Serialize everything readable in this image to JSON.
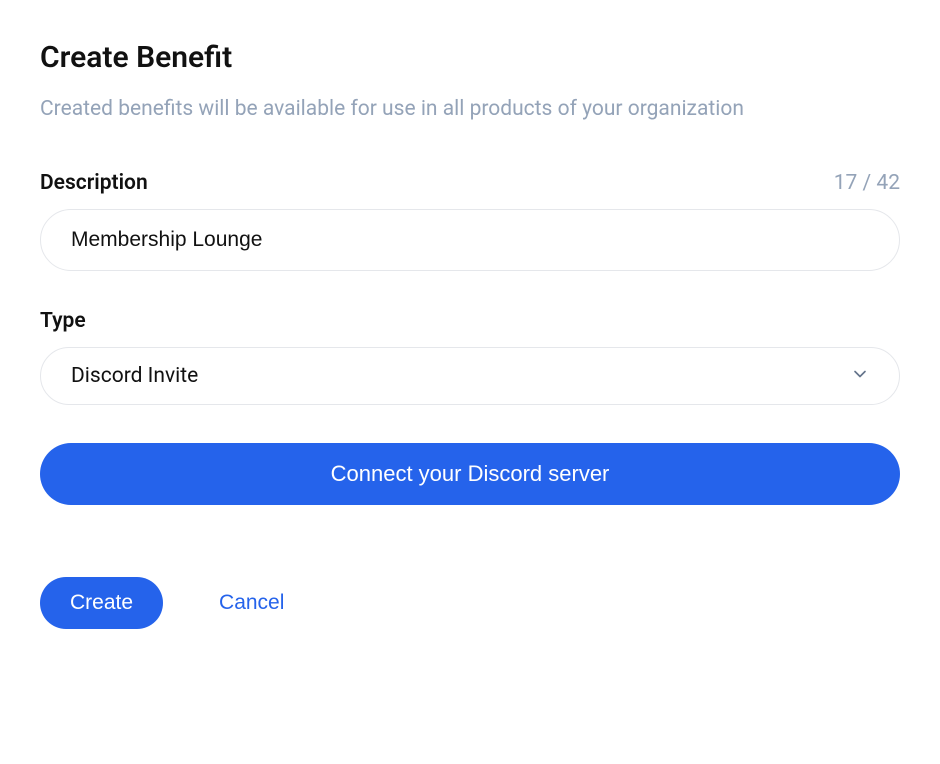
{
  "header": {
    "title": "Create Benefit",
    "subtitle": "Created benefits will be available for use in all products of your organization"
  },
  "description": {
    "label": "Description",
    "value": "Membership Lounge",
    "char_count": "17 / 42"
  },
  "type": {
    "label": "Type",
    "selected": "Discord Invite"
  },
  "connect": {
    "label": "Connect your Discord server"
  },
  "actions": {
    "create": "Create",
    "cancel": "Cancel"
  },
  "colors": {
    "primary": "#2563eb",
    "muted": "#94a3b8",
    "border": "#e5e7eb",
    "text": "#111111"
  }
}
